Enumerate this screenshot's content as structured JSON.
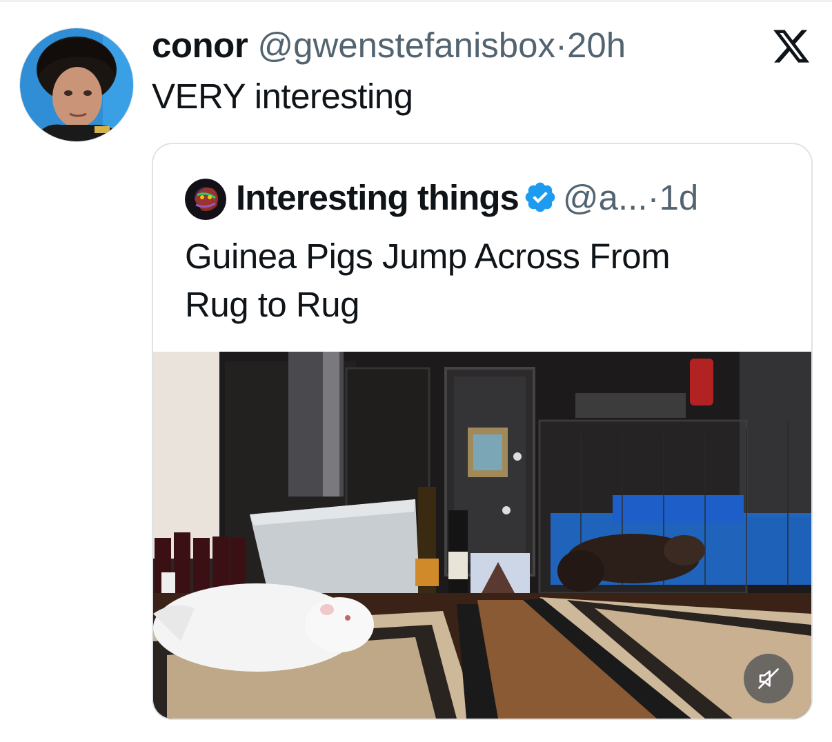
{
  "tweet": {
    "display_name": "conor",
    "handle": "@gwenstefanisbox",
    "separator": "·",
    "time": "20h",
    "text": "VERY interesting"
  },
  "quote": {
    "display_name": "Interesting things",
    "verified": true,
    "handle": "@a...",
    "separator": "·",
    "time": "1d",
    "text_line1": "Guinea Pigs Jump Across From",
    "text_line2": "Rug to Rug"
  },
  "icons": {
    "brand": "x-logo-icon",
    "verified": "verified-badge-icon",
    "mute": "muted-speaker-icon"
  },
  "colors": {
    "text_primary": "#0f1419",
    "text_secondary": "#536471",
    "verified_blue": "#1d9bf0",
    "card_border": "#dfe3e6"
  }
}
